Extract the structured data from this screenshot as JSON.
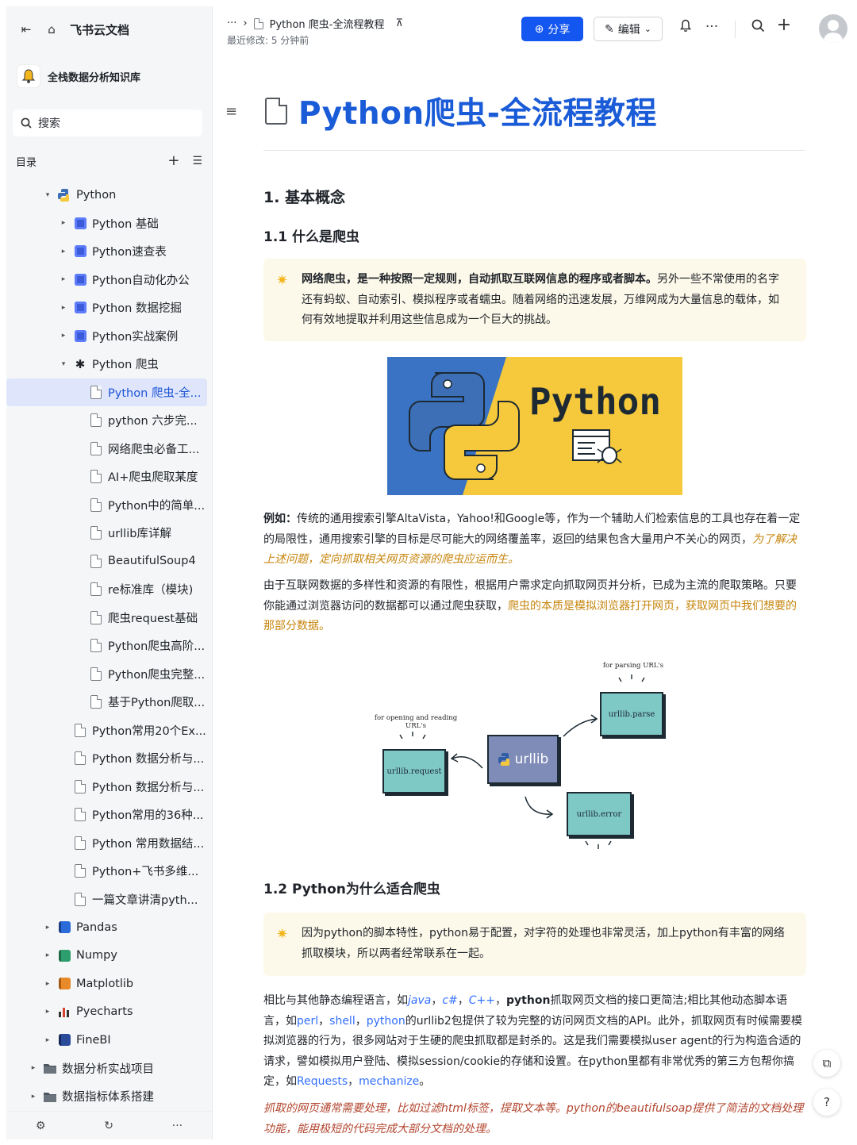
{
  "app": {
    "name": "飞书云文档",
    "knowledge_base": "全栈数据分析知识库",
    "search_label": "搜索",
    "toc_label": "目录"
  },
  "tree": [
    {
      "label": "Python",
      "level": 0,
      "expanded": true,
      "icon": "python-logo-icon"
    },
    {
      "label": "Python 基础",
      "level": 1,
      "collapsed": true,
      "icon": "blue-square-icon"
    },
    {
      "label": "Python速查表",
      "level": 1,
      "collapsed": true,
      "icon": "blue-square-icon"
    },
    {
      "label": "Python自动化办公",
      "level": 1,
      "collapsed": true,
      "icon": "blue-square-icon"
    },
    {
      "label": "Python 数据挖掘",
      "level": 1,
      "collapsed": true,
      "icon": "blue-square-icon"
    },
    {
      "label": "Python实战案例",
      "level": 1,
      "collapsed": true,
      "icon": "blue-square-icon"
    },
    {
      "label": "Python 爬虫",
      "level": 1,
      "expanded": true,
      "icon": "spider-icon"
    },
    {
      "label": "Python 爬虫-全...",
      "level": 2,
      "active": true,
      "icon": "doc-icon"
    },
    {
      "label": "python 六步完...",
      "level": 2,
      "icon": "doc-icon"
    },
    {
      "label": "网络爬虫必备工...",
      "level": 2,
      "icon": "doc-icon"
    },
    {
      "label": "AI+爬虫爬取某度",
      "level": 2,
      "icon": "doc-icon"
    },
    {
      "label": "Python中的简单...",
      "level": 2,
      "icon": "doc-icon"
    },
    {
      "label": "urllib库详解",
      "level": 2,
      "icon": "doc-icon"
    },
    {
      "label": "BeautifulSoup4",
      "level": 2,
      "icon": "doc-icon"
    },
    {
      "label": "re标准库（模块)",
      "level": 2,
      "icon": "doc-icon"
    },
    {
      "label": "爬虫request基础",
      "level": 2,
      "icon": "doc-icon"
    },
    {
      "label": "Python爬虫高阶...",
      "level": 2,
      "icon": "doc-icon"
    },
    {
      "label": "Python爬虫完整...",
      "level": 2,
      "icon": "doc-icon"
    },
    {
      "label": "基于Python爬取...",
      "level": 2,
      "icon": "doc-icon"
    },
    {
      "label": "Python常用20个Ex...",
      "level": 1,
      "icon": "doc-icon"
    },
    {
      "label": "Python 数据分析与...",
      "level": 1,
      "icon": "doc-icon"
    },
    {
      "label": "Python 数据分析与...",
      "level": 1,
      "icon": "doc-icon"
    },
    {
      "label": "Python常用的36种...",
      "level": 1,
      "icon": "doc-icon"
    },
    {
      "label": "Python 常用数据结...",
      "level": 1,
      "icon": "doc-icon"
    },
    {
      "label": "Python+飞书多维...",
      "level": 1,
      "icon": "doc-icon"
    },
    {
      "label": "一篇文章讲清pyth...",
      "level": 1,
      "icon": "doc-icon"
    },
    {
      "label": "Pandas",
      "level": 0,
      "collapsed": true,
      "icon": "book-blue-icon"
    },
    {
      "label": "Numpy",
      "level": 0,
      "collapsed": true,
      "icon": "book-green-icon"
    },
    {
      "label": "Matplotlib",
      "level": 0,
      "collapsed": true,
      "icon": "book-orange-icon"
    },
    {
      "label": "Pyecharts",
      "level": 0,
      "collapsed": true,
      "icon": "bar-chart-icon"
    },
    {
      "label": "FineBI",
      "level": 0,
      "collapsed": true,
      "icon": "book-navy-icon"
    },
    {
      "label": "数据分析实战项目",
      "level": -1,
      "collapsed": true,
      "icon": "folder-icon"
    },
    {
      "label": "数据指标体系搭建",
      "level": -1,
      "collapsed": true,
      "icon": "folder-icon"
    }
  ],
  "header": {
    "breadcrumb_more": "···",
    "breadcrumb_title": "Python 爬虫-全流程教程",
    "modified": "最近修改: 5 分钟前",
    "share_label": "分享",
    "edit_label": "编辑"
  },
  "doc": {
    "title": "Python爬虫-全流程教程",
    "h1": "1. 基本概念",
    "h2_1": "1.1 什么是爬虫",
    "callout1_bold": "网络爬虫，是一种按照一定规则，自动抓取互联网信息的程序或者脚本。",
    "callout1_rest": "另外一些不常使用的名字还有蚂蚁、自动索引、模拟程序或者蠕虫。随着网络的迅速发展，万维网成为大量信息的载体，如何有效地提取并利用这些信息成为一个巨大的挑战。",
    "image_word": "Python",
    "p1_bold": "例如：",
    "p1_text": "传统的通用搜索引擎AltaVista，Yahoo!和Google等，作为一个辅助人们检索信息的工具也存在着一定的局限性，通用搜索引擎的目标是尽可能大的网络覆盖率，返回的结果包含大量用户不关心的网页，",
    "p1_hl": "为了解决上述问题，定向抓取相关网页资源的爬虫应运而生。",
    "p2_text": "由于互联网数据的多样性和资源的有限性，根据用户需求定向抓取网页并分析，已成为主流的爬取策略。只要你能通过浏览器访问的数据都可以通过爬虫获取，",
    "p2_hl": "爬虫的本质是模拟浏览器打开网页，获取网页中我们想要的那部分数据。",
    "diagram": {
      "center": "urllib",
      "request": "urllib.request",
      "parse": "urllib.parse",
      "error": "urllib.error",
      "cap_request": "for opening and reading URL's",
      "cap_parse": "for parsing URL's"
    },
    "h2_2": "1.2 Python为什么适合爬虫",
    "callout2": "因为python的脚本特性，python易于配置，对字符的处理也非常灵活，加上python有丰富的网络抓取模块，所以两者经常联系在一起。",
    "p3_a": "相比与其他静态编程语言，如",
    "p3_java": "java",
    "p3_sep1": "，",
    "p3_cs": "c#",
    "p3_sep2": "，",
    "p3_cpp": "C++",
    "p3_sep3": "，",
    "p3_python": "python",
    "p3_b": "抓取网页文档的接口更简洁;相比其他动态脚本语言，如",
    "p3_perl": "perl",
    "p3_sep4": "，",
    "p3_shell": "shell",
    "p3_sep5": "，",
    "p3_python2": "python",
    "p3_c": "的urllib2包提供了较为完整的访问网页文档的API。此外，抓取网页有时候需要模拟浏览器的行为，很多网站对于生硬的爬虫抓取都是封杀的。这是我们需要模拟user agent的行为构造合适的请求，譬如模拟用户登陆、模拟session/cookie的存储和设置。在python里都有非常优秀的第三方包帮你搞定，如",
    "p3_requests": "Requests",
    "p3_sep6": "，",
    "p3_mechanize": "mechanize",
    "p3_end": "。",
    "p4": "抓取的网页通常需要处理，比如过滤html标签，提取文本等。python的beautifulsoap提供了简洁的文档处理功能，能用极短的代码完成大部分文档的处理。"
  },
  "bottom_bar": {
    "more": "···"
  },
  "colors": {
    "accent": "#1456f0",
    "title_blue": "#1a5bd7",
    "callout_bg": "#fdf9ea",
    "highlight": "#c6850d"
  }
}
